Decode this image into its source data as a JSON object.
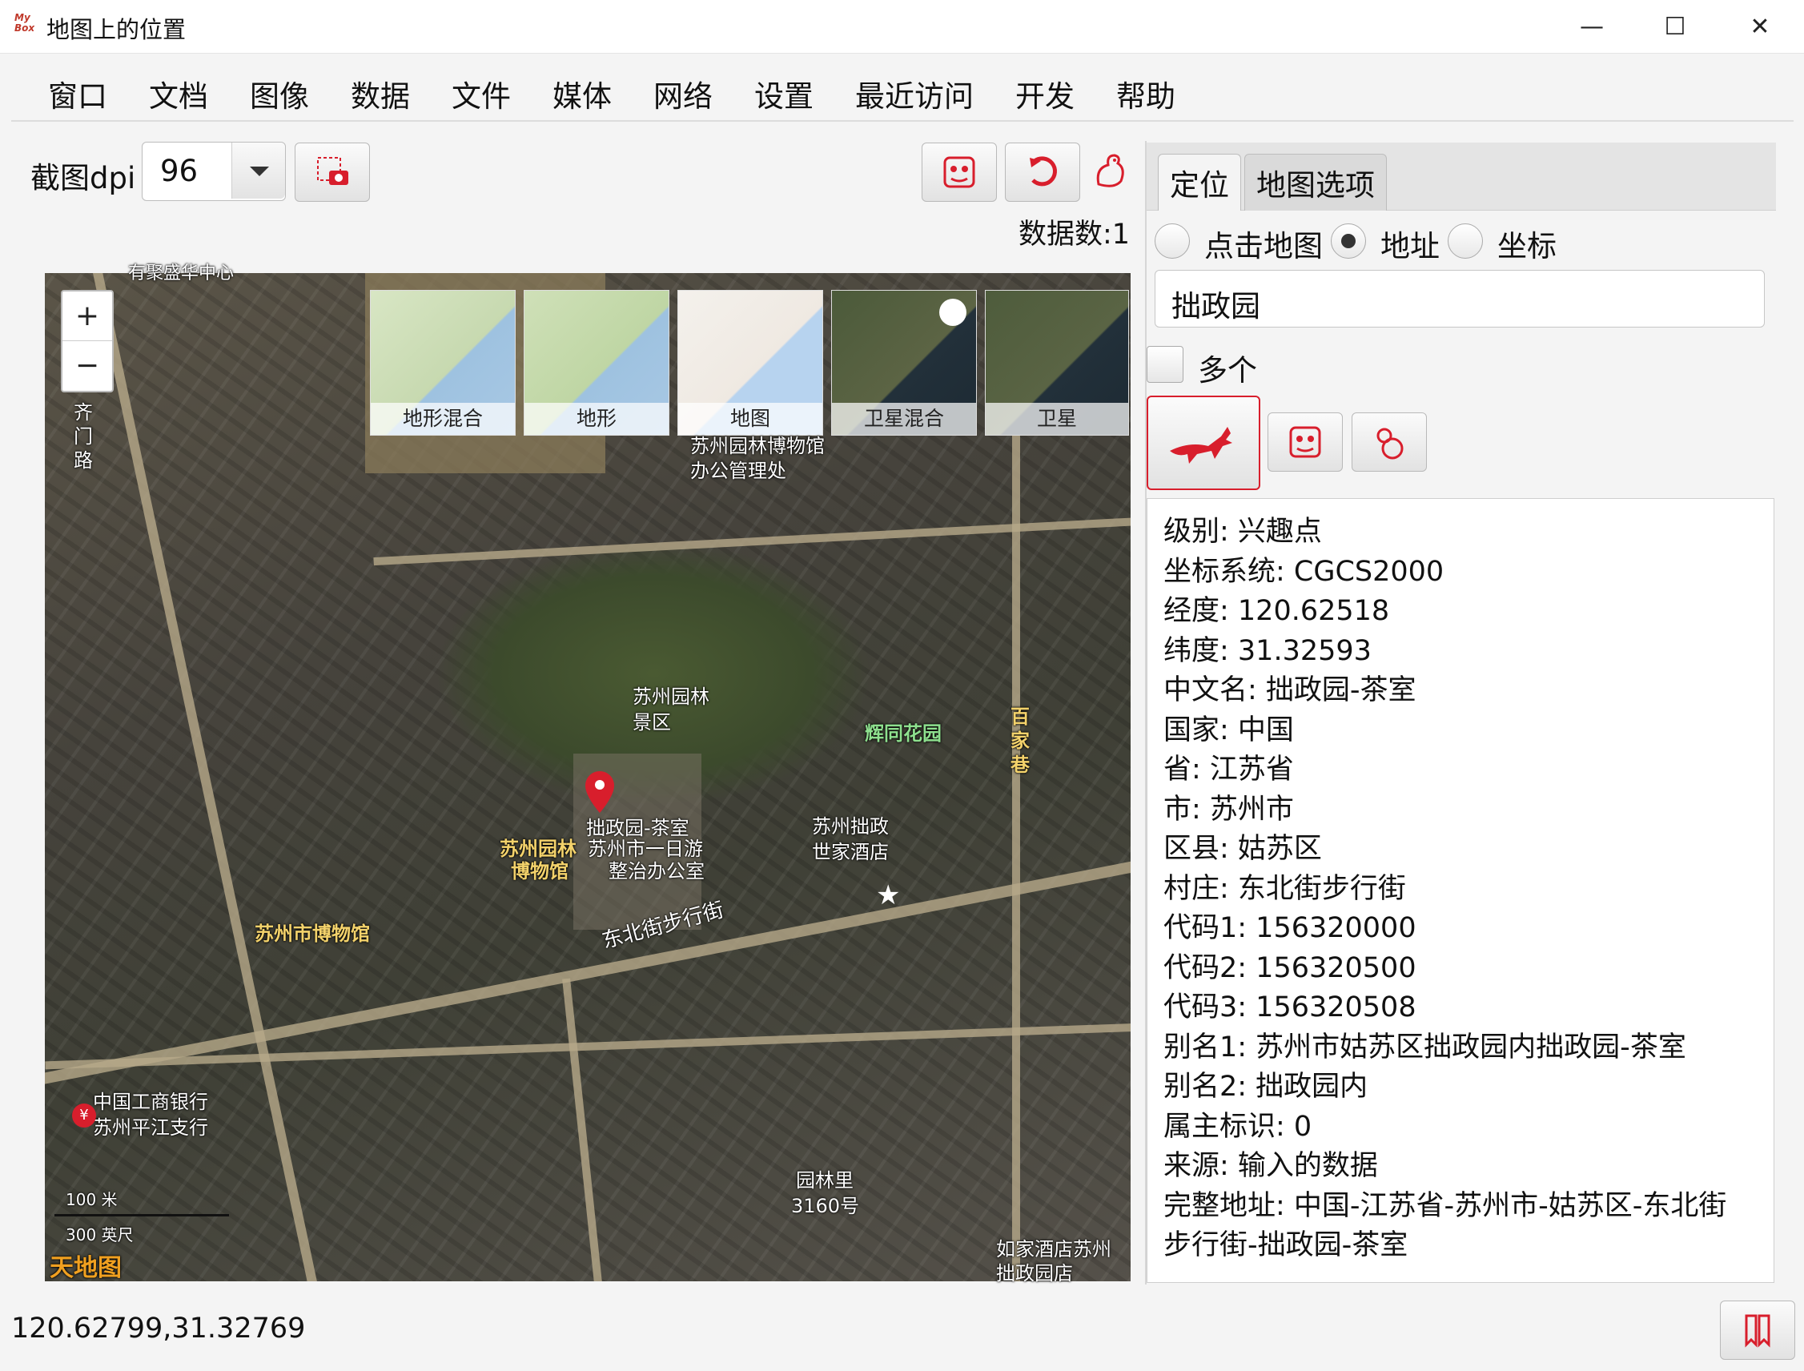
{
  "window": {
    "app_icon_text": "My Box",
    "title": "地图上的位置",
    "minimize": "—",
    "maximize": "☐",
    "close": "✕"
  },
  "menu": [
    "窗口",
    "文档",
    "图像",
    "数据",
    "文件",
    "媒体",
    "网络",
    "设置",
    "最近访问",
    "开发",
    "帮助"
  ],
  "toolbar": {
    "dpi_label": "截图dpi",
    "dpi_value": "96",
    "data_count": "数据数:1"
  },
  "map": {
    "zoom_in": "+",
    "zoom_out": "−",
    "layers": [
      {
        "label": "地形混合",
        "selected": false
      },
      {
        "label": "地形",
        "selected": false
      },
      {
        "label": "地图",
        "selected": false
      },
      {
        "label": "卫星混合",
        "selected": true
      },
      {
        "label": "卫星",
        "selected": false
      }
    ],
    "labels": {
      "museum_office_1": "苏州园林博物馆",
      "museum_office_2": "办公管理处",
      "scenic_1": "苏州园林",
      "scenic_2": "景区",
      "huitong": "辉同花园",
      "baijiaxiang": "百家巷",
      "pin_label": "拙政园-茶室",
      "yiri_1": "苏州市一日游",
      "yiri_2": "整治办公室",
      "museum_yellow_1": "苏州园林",
      "museum_yellow_2": "博物馆",
      "hotel_1": "苏州拙政",
      "hotel_2": "世家酒店",
      "suzhou_museum": "苏州市博物馆",
      "street": "东北街步行街",
      "icbc_1": "中国工商银行",
      "icbc_2": "苏州平江支行",
      "yuanlinli_1": "园林里",
      "yuanlinli_2": "3160号",
      "rujia_1": "如家酒店苏州",
      "rujia_2": "拙政园店",
      "qimen_road": "齐门路",
      "top_partial": "有聚盛华中心",
      "scale_m": "100 米",
      "scale_ft": "300 英尺",
      "logo": "天地图"
    },
    "accent": "#d81e2c"
  },
  "right": {
    "tabs": [
      "定位",
      "地图选项"
    ],
    "radios": [
      {
        "label": "点击地图",
        "checked": false
      },
      {
        "label": "地址",
        "checked": true
      },
      {
        "label": "坐标",
        "checked": false
      }
    ],
    "address": "拙政园",
    "multiple_label": "多个",
    "info": [
      "级别: 兴趣点",
      "坐标系统: CGCS2000",
      "经度: 120.62518",
      "纬度: 31.32593",
      "中文名: 拙政园-茶室",
      "国家: 中国",
      "省: 江苏省",
      "市: 苏州市",
      "区县: 姑苏区",
      "村庄: 东北街步行街",
      "代码1: 156320000",
      "代码2: 156320500",
      "代码3: 156320508",
      "别名1: 苏州市姑苏区拙政园内拙政园-茶室",
      "别名2: 拙政园内",
      "属主标识: 0",
      "来源: 输入的数据",
      "完整地址: 中国-江苏省-苏州市-姑苏区-东北街",
      "步行街-拙政园-茶室"
    ]
  },
  "status": {
    "coordinates": "120.62799,31.32769"
  }
}
